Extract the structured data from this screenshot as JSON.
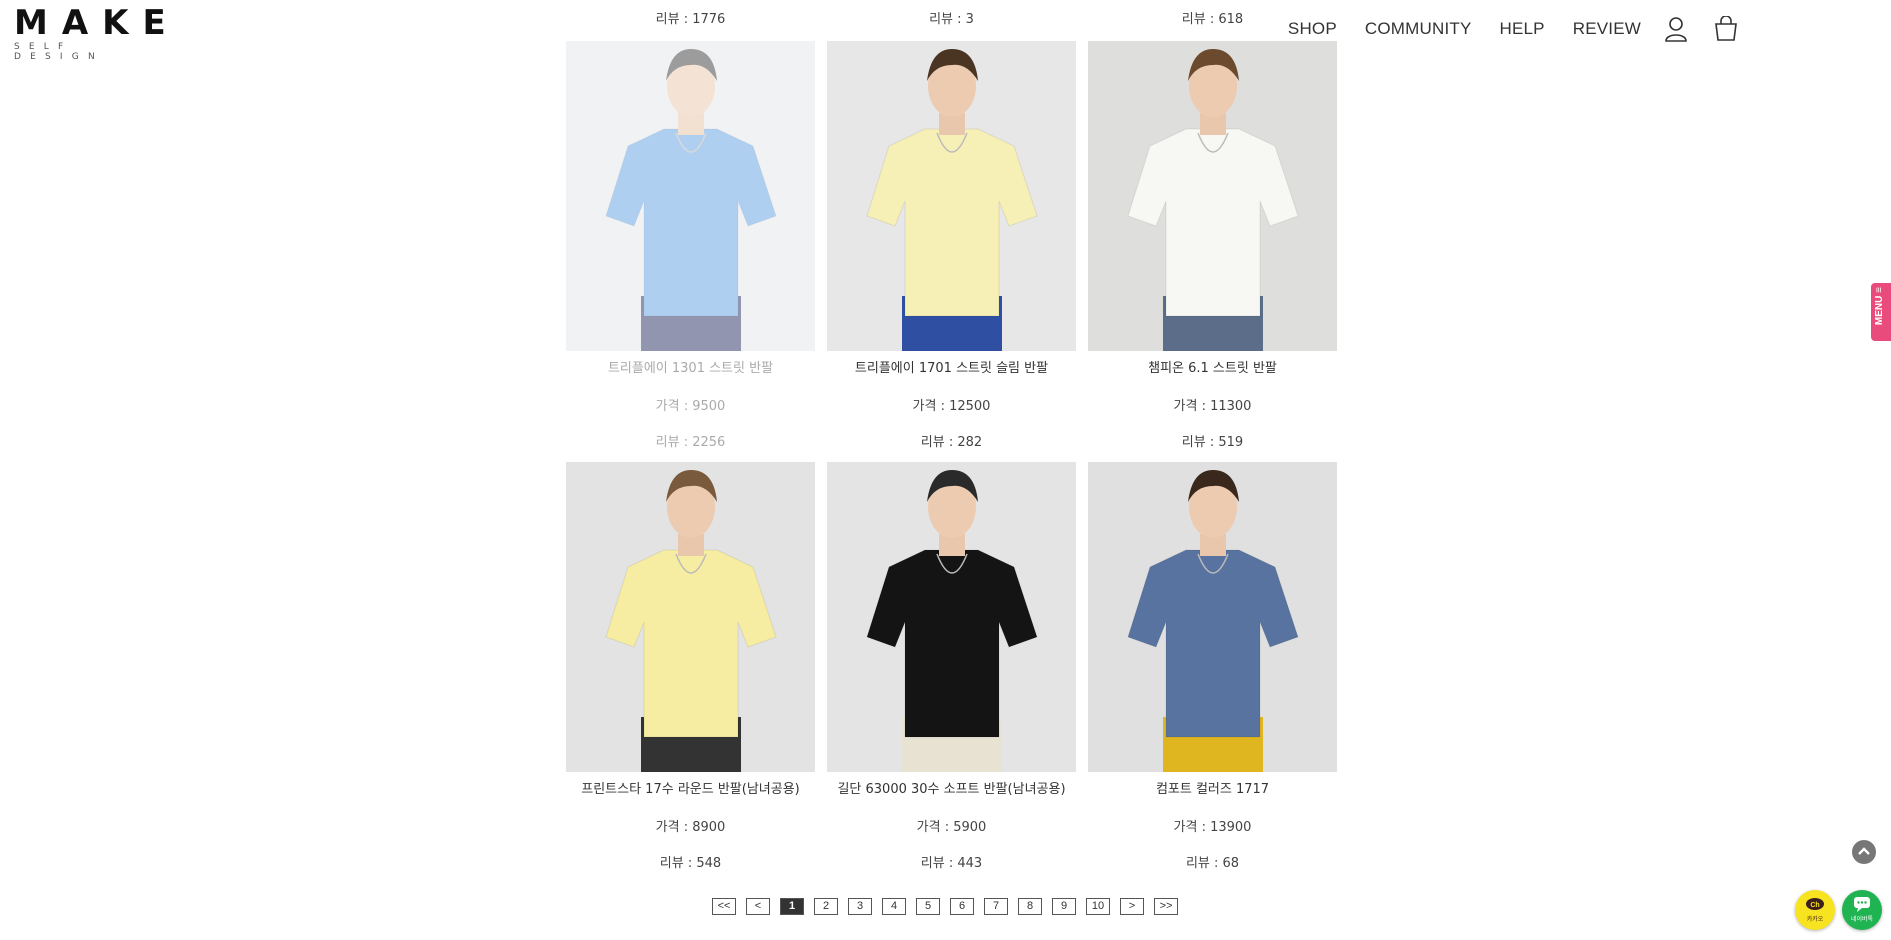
{
  "logo": {
    "mark": "MAKE",
    "sub": "SELF DESIGN"
  },
  "nav": {
    "shop": "SHOP",
    "community": "COMMUNITY",
    "help": "HELP",
    "review": "REVIEW"
  },
  "top_reviews": [
    "리뷰 :  1776",
    "리뷰 :  3",
    "리뷰 :  618"
  ],
  "products": [
    {
      "name": "트리플에이 1301 스트릿 반팔",
      "price": "가격 :  9500",
      "review": "리뷰 :  2256",
      "shirt": "#6fa8e6",
      "bg": "#e6e8ea",
      "hair": "#4c4c4c",
      "pants": "#3a3f6e"
    },
    {
      "name": "트리플에이 1701 스트릿 슬림 반팔",
      "price": "가격 :  12500",
      "review": "리뷰 :  282",
      "shirt": "#f6f0b6",
      "bg": "#e7e7e7",
      "hair": "#4a3422",
      "pants": "#2f4fa2"
    },
    {
      "name": "챔피온 6.1 스트릿 반팔",
      "price": "가격 :  11300",
      "review": "리뷰 :  519",
      "shirt": "#f7f7f4",
      "bg": "#dededd",
      "hair": "#6c4a2e",
      "pants": "#5b6d88"
    },
    {
      "name": "프린트스타 17수 라운드 반팔(남녀공용)",
      "price": "가격 :  8900",
      "review": "리뷰 :  548",
      "shirt": "#f6eda2",
      "bg": "#e3e3e3",
      "hair": "#7a5a3c",
      "pants": "#333333"
    },
    {
      "name": "길단 63000 30수 소프트 반팔(남녀공용)",
      "price": "가격 :  5900",
      "review": "리뷰 :  443",
      "shirt": "#141414",
      "bg": "#e4e4e4",
      "hair": "#2a2a2a",
      "pants": "#e8e2d2"
    },
    {
      "name": "컴포트 컬러즈 1717",
      "price": "가격 :  13900",
      "review": "리뷰 :  68",
      "shirt": "#58739f",
      "bg": "#e0e0e0",
      "hair": "#3a281c",
      "pants": "#e0b620"
    }
  ],
  "pagination": [
    "<<",
    "<",
    "1",
    "2",
    "3",
    "4",
    "5",
    "6",
    "7",
    "8",
    "9",
    "10",
    ">",
    ">>"
  ],
  "current_page": "1",
  "side_tab": "MENU ≡",
  "chat": {
    "channel": "카카오",
    "talk": "네이버톡"
  },
  "colors": {
    "accent": "#e94c7c",
    "kakao": "#f7e31f",
    "talk": "#1fb351"
  }
}
